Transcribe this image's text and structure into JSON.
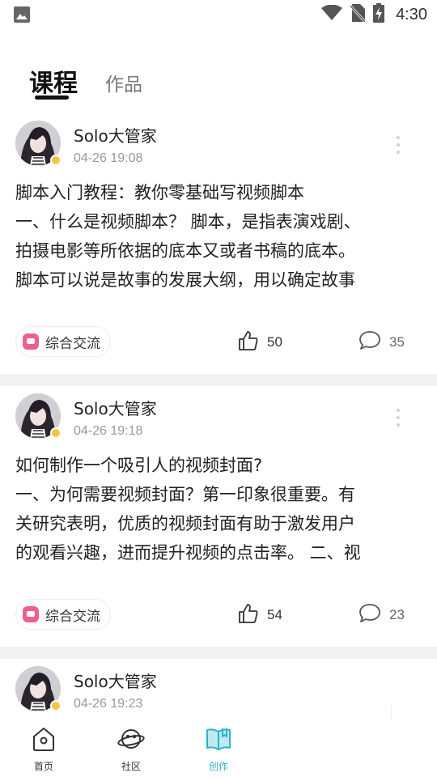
{
  "status_bar": {
    "time": "4:30",
    "icons": [
      "image-icon",
      "wifi-icon",
      "no-sim-icon",
      "battery-charging-icon"
    ]
  },
  "tabs": [
    {
      "label": "课程",
      "active": true
    },
    {
      "label": "作品",
      "active": false
    }
  ],
  "posts": [
    {
      "author": "Solo大管家",
      "time": "04-26 19:08",
      "lines": [
        "脚本入门教程：教你零基础写视频脚本",
        "一、什么是视频脚本？ 脚本，是指表演戏剧、",
        "拍摄电影等所依据的底本又或者书稿的底本。",
        "脚本可以说是故事的发展大纲，用以确定故事"
      ],
      "tag": "综合交流",
      "likes": "50",
      "comments": "35"
    },
    {
      "author": "Solo大管家",
      "time": "04-26 19:18",
      "lines": [
        "如何制作一个吸引人的视频封面?",
        "一、为何需要视频封面？第一印象很重要。有",
        "关研究表明，优质的视频封面有助于激发用户",
        "的观看兴趣，进而提升视频的点击率。 二、视"
      ],
      "tag": "综合交流",
      "likes": "54",
      "comments": "23"
    },
    {
      "author": "Solo大管家",
      "time": "04-26 19:23"
    }
  ],
  "bottom_nav": [
    {
      "label": "首页",
      "icon": "home-icon",
      "active": false
    },
    {
      "label": "社区",
      "icon": "planet-icon",
      "active": false
    },
    {
      "label": "创作",
      "icon": "book-icon",
      "active": true
    }
  ],
  "colors": {
    "accent": "#2ab3c8",
    "tag_icon": "#ef5f8c",
    "verified_badge": "#f6c443",
    "divider": "#f2f2f2"
  }
}
